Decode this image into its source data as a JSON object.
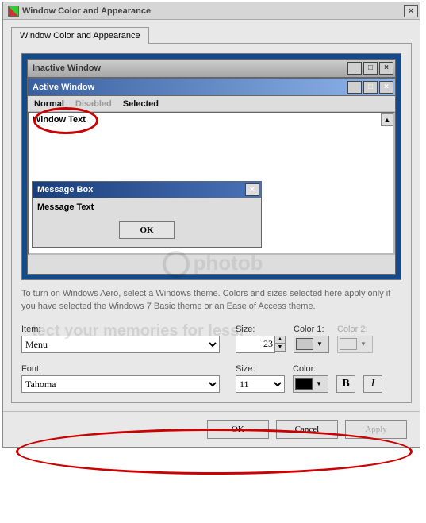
{
  "outer": {
    "title": "Window Color and Appearance",
    "close_glyph": "×"
  },
  "tab": {
    "label": "Window Color and Appearance"
  },
  "preview": {
    "inactive_title": "Inactive Window",
    "active_title": "Active Window",
    "menu": {
      "normal": "Normal",
      "disabled": "Disabled",
      "selected": "Selected"
    },
    "window_text": "Window Text",
    "scroll_up": "▲",
    "msgbox_title": "Message Box",
    "msgbox_text": "Message Text",
    "ok_label": "OK",
    "win_min": "_",
    "win_max": "□",
    "win_close": "×"
  },
  "description": "To turn on Windows Aero, select a Windows theme.  Colors and sizes selected here apply only if you have selected the Windows 7 Basic theme or an Ease of Access theme.",
  "labels": {
    "item": "Item:",
    "size": "Size:",
    "color1": "Color 1:",
    "color2": "Color 2:",
    "font": "Font:",
    "font_size": "Size:",
    "color": "Color:"
  },
  "values": {
    "item_selected": "Menu",
    "item_size": "23",
    "item_color1": "#c8c8c8",
    "font_selected": "Tahoma",
    "font_size": "11",
    "font_color": "#000000",
    "bold_label": "B",
    "italic_label": "I",
    "dropdown_arrow": "▼",
    "spin_up": "▲",
    "spin_down": "▼"
  },
  "buttons": {
    "ok": "OK",
    "cancel": "Cancel",
    "apply": "Apply"
  },
  "watermark": {
    "logo": "photob",
    "tagline": "tect your memories for less!"
  }
}
